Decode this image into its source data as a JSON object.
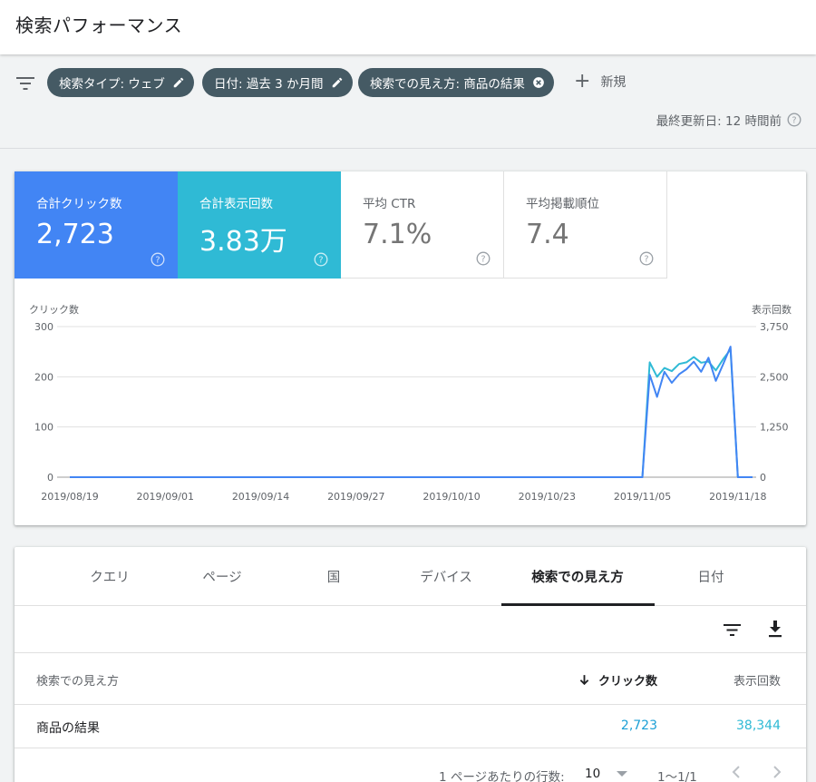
{
  "header": {
    "title": "検索パフォーマンス"
  },
  "filters": {
    "chips": [
      {
        "label": "検索タイプ: ウェブ",
        "icon": "pencil-icon"
      },
      {
        "label": "日付: 過去 3 か月間",
        "icon": "pencil-icon"
      },
      {
        "label": "検索での見え方: 商品の結果",
        "icon": "close-circle-icon"
      }
    ],
    "new_label": "新規",
    "last_updated": "最終更新日: 12 時間前"
  },
  "metrics": [
    {
      "label": "合計クリック数",
      "value": "2,723"
    },
    {
      "label": "合計表示回数",
      "value": "3.83万"
    },
    {
      "label": "平均 CTR",
      "value": "7.1%"
    },
    {
      "label": "平均掲載順位",
      "value": "7.4"
    }
  ],
  "colors": {
    "clicks": "#4285f4",
    "impressions": "#2fbad5",
    "chip_bg": "#455a64",
    "link": "#1a9fd6"
  },
  "chart_data": {
    "type": "line",
    "left_axis_label": "クリック数",
    "right_axis_label": "表示回数",
    "left_ticks": [
      "300",
      "200",
      "100",
      "0"
    ],
    "right_ticks": [
      "3,750",
      "2,500",
      "1,250",
      "0"
    ],
    "left_range": [
      0,
      300
    ],
    "right_range": [
      0,
      3750
    ],
    "x_labels": [
      "2019/08/19",
      "2019/09/01",
      "2019/09/14",
      "2019/09/27",
      "2019/10/10",
      "2019/10/23",
      "2019/11/05",
      "2019/11/18"
    ],
    "x_label_start_index": 0,
    "x_label_interval": 13,
    "n_points": 94,
    "tail_start_index": 78,
    "series": [
      {
        "name": "表示回数",
        "axis": "right",
        "zero_until_index": 78,
        "tail_values": [
          0,
          2860,
          2500,
          2720,
          2640,
          2820,
          2860,
          2990,
          2850,
          2880,
          2660,
          2940,
          3180
        ]
      },
      {
        "name": "クリック数",
        "axis": "left",
        "zero_until_index": 78,
        "tail_values": [
          0,
          204,
          160,
          210,
          188,
          205,
          215,
          230,
          210,
          238,
          192,
          225,
          260
        ]
      }
    ]
  },
  "table": {
    "tabs": [
      "クエリ",
      "ページ",
      "国",
      "デバイス",
      "検索での見え方",
      "日付"
    ],
    "active_tab": 4,
    "columns": [
      "検索での見え方",
      "クリック数",
      "表示回数"
    ],
    "rows": [
      {
        "appearance": "商品の結果",
        "clicks": "2,723",
        "impressions": "38,344"
      }
    ],
    "pager": {
      "rows_per_page_label": "1 ページあたりの行数:",
      "rows_per_page": "10",
      "range": "1〜1/1"
    }
  }
}
